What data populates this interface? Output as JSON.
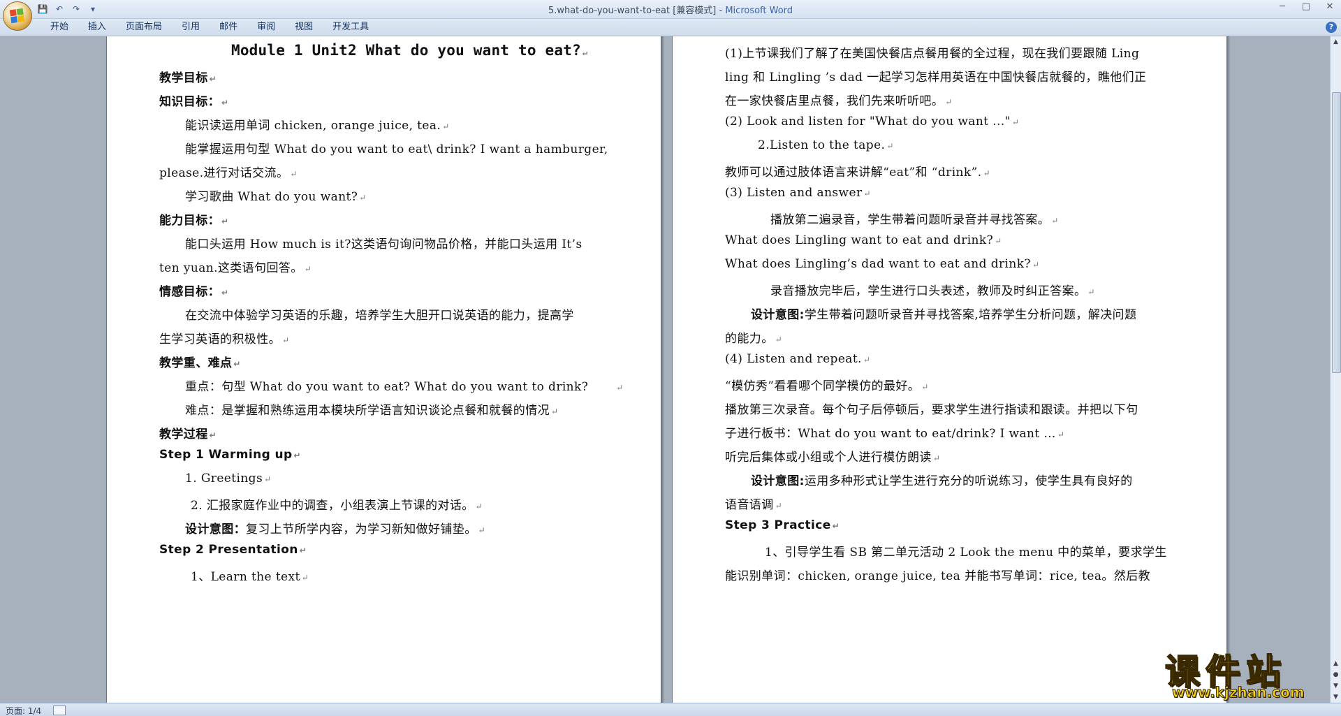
{
  "window": {
    "title_doc": "5.what-do-you-want-to-eat [兼容模式] - ",
    "title_app": "Microsoft Word",
    "qat": {
      "save": "💾",
      "undo": "↶",
      "redo": "↷",
      "more": "▾"
    },
    "controls": {
      "minimize": "─",
      "maximize": "□",
      "close": "✕"
    }
  },
  "ribbon": {
    "tabs": [
      "开始",
      "插入",
      "页面布局",
      "引用",
      "邮件",
      "审阅",
      "视图",
      "开发工具"
    ],
    "help": "?"
  },
  "left_page": {
    "title": "Module 1 Unit2  What do you want to eat?",
    "l1": "教学目标",
    "l2": "知识目标：",
    "l3": "能识读运用单词 chicken, orange juice, tea.",
    "l4": "能掌握运用句型 What do you want to eat\\ drink? I want a hamburger,",
    "l5": "please.进行对话交流。",
    "l6": "学习歌曲 What do you want?",
    "l7": "能力目标：",
    "l8": "能口头运用 How much is it?这类语句询问物品价格，并能口头运用 It’s",
    "l9": "ten yuan.这类语句回答。",
    "l10": "情感目标：",
    "l11": "在交流中体验学习英语的乐趣，培养学生大胆开口说英语的能力，提高学",
    "l12": "生学习英语的积极性。",
    "l13": "教学重、难点",
    "l14": "重点：句型 What do you want to eat? What do you want to drink?",
    "l15": "难点：是掌握和熟练运用本模块所学语言知识谈论点餐和就餐的情况",
    "l16": "教学过程",
    "l17": "Step 1 Warming up",
    "l18": "1.   Greetings",
    "l19": "2. 汇报家庭作业中的调查，小组表演上节课的对话。",
    "l20a": "设计意图：",
    "l20b": "复习上节所学内容，为学习新知做好铺垫。",
    "l21": "Step 2 Presentation",
    "l22": "1、Learn the text"
  },
  "right_page": {
    "r1": "(1)上节课我们了解了在美国快餐店点餐用餐的全过程，现在我们要跟随 Ling",
    "r2": "ling 和 Lingling ’s dad 一起学习怎样用英语在中国快餐店就餐的，瞧他们正",
    "r3": "在一家快餐店里点餐，我们先来听听吧。",
    "r4": "(2) Look and listen for \"What do you want ...\"",
    "r5": "2.Listen to the tape.",
    "r6": "教师可以通过肢体语言来讲解“eat”和 “drink”.",
    "r7": "(3) Listen and answer",
    "r8": "播放第二遍录音，学生带着问题听录音并寻找答案。",
    "r9": "What does Lingling want to eat and drink?",
    "r10": "What does Lingling’s dad want to eat and drink?",
    "r11": "录音播放完毕后，学生进行口头表述，教师及时纠正答案。",
    "r12a": "设计意图:",
    "r12b": "学生带着问题听录音并寻找答案,培养学生分析问题，解决问题",
    "r13": "的能力。",
    "r14": "(4) Listen and repeat.",
    "r15": "“模仿秀”看看哪个同学模仿的最好。",
    "r16": "播放第三次录音。每个句子后停顿后，要求学生进行指读和跟读。并把以下句",
    "r17": "子进行板书：What do you want to eat/drink? I want …",
    "r18": "听完后集体或小组或个人进行模仿朗读",
    "r19a": "设计意图:",
    "r19b": "运用多种形式让学生进行充分的听说练习，使学生具有良好的",
    "r20": "语音语调",
    "r21": "Step 3 Practice",
    "r22": "1、引导学生看 SB 第二单元活动 2 Look the menu 中的菜单，要求学生",
    "r23": "能识别单词：chicken, orange juice, tea 并能书写单词：rice, tea。然后教"
  },
  "status": {
    "page": "页面: 1/4"
  },
  "watermark": {
    "title": "课件站",
    "url": "www.kjzhan.com"
  },
  "colors": {
    "accent": "#3b63b0",
    "workspace": "#a7b1bd",
    "watermark": "#f6d21b"
  }
}
